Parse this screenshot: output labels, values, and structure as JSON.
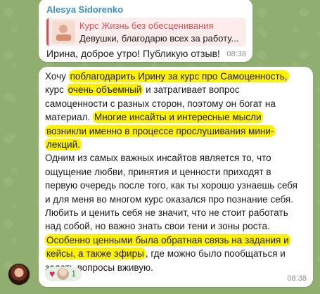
{
  "colors": {
    "accent_blue": "#3e8fc7",
    "reply_red": "#d95353",
    "highlight": "#fff200",
    "heart": "#e0245e"
  },
  "messages": [
    {
      "sender": "Alesya Sidorenko",
      "reply": {
        "title": "Курс Жизнь без обесценивания",
        "text": "Девушки, благодарю всех за работу..."
      },
      "text": "Ирина, доброе утро! Публикую отзыв!",
      "time": "08:38"
    },
    {
      "lines": [
        [
          {
            "t": "Хочу "
          },
          {
            "t": "поблагодарить Ирину за курс про Самоценность,",
            "hl": true
          }
        ],
        [
          {
            "t": "курс "
          },
          {
            "t": "очень объемный",
            "hl": true
          },
          {
            "t": " и затрагивает вопрос"
          }
        ],
        [
          {
            "t": "самоценности с разных сторон, поэтому он богат на"
          }
        ],
        [
          {
            "t": "материал. "
          },
          {
            "t": "Многие инсайты и интересные мысли",
            "hl": true
          }
        ],
        [
          {
            "t": "возникли именно в процессе прослушивания мини-",
            "hl": true
          }
        ],
        [
          {
            "t": "лекций.",
            "hl": true
          }
        ],
        [
          {
            "t": "Одним из самых важных инсайтов является то, что"
          }
        ],
        [
          {
            "t": "ощущение любви, принятия и ценности приходят в"
          }
        ],
        [
          {
            "t": "первую очередь после того, как ты хорошо узнаешь себя"
          }
        ],
        [
          {
            "t": "и для меня во многом курс оказался про познание себя."
          }
        ],
        [
          {
            "t": "Любить и ценить себя не значит, что не стоит работать"
          }
        ],
        [
          {
            "t": "над собой, но важно знать свои тени и зоны роста."
          }
        ],
        [
          {
            "t": "Особенно ценными была обратная связь на задания и",
            "hl": true
          }
        ],
        [
          {
            "t": "кейсы, а также эфиры",
            "hl": true
          },
          {
            "t": ", где можно было пообщаться и"
          }
        ],
        [
          {
            "t": "задать вопросы вживую."
          }
        ]
      ],
      "reactions": {
        "heart": "♥",
        "count": "1"
      },
      "time": "08:38"
    }
  ],
  "icons": {
    "reaction": "heart-icon",
    "reactor": "avatar-icon"
  }
}
